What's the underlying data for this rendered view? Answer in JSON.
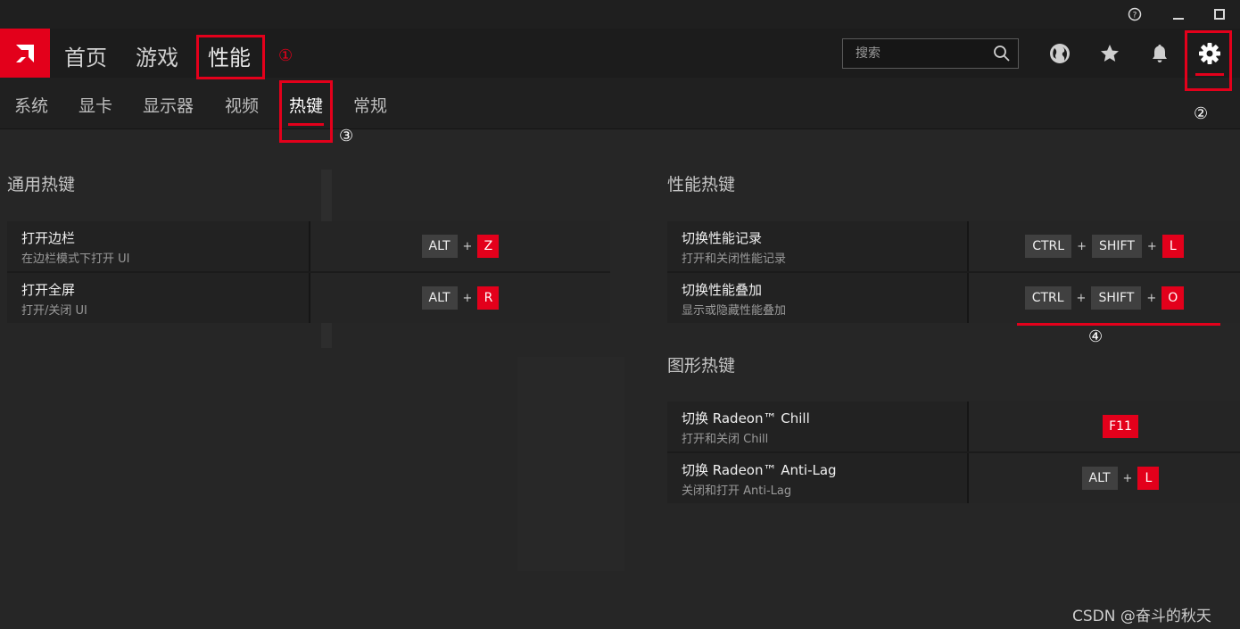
{
  "titlebar": {
    "help_icon": "question-circle-icon",
    "minimize_icon": "minimize-icon",
    "maximize_icon": "maximize-icon"
  },
  "topnav": {
    "items": [
      "首页",
      "游戏",
      "性能"
    ],
    "search_placeholder": "搜索",
    "icons": [
      "globe-icon",
      "star-icon",
      "bell-icon",
      "gear-icon"
    ]
  },
  "subnav": {
    "items": [
      "系统",
      "显卡",
      "显示器",
      "视频",
      "热键",
      "常规"
    ],
    "active": "热键"
  },
  "annotations": [
    "①",
    "②",
    "③",
    "④"
  ],
  "general_hotkeys": {
    "title": "通用热键",
    "rows": [
      {
        "name": "打开边栏",
        "desc": "在边栏模式下打开 UI",
        "keys": [
          "ALT",
          "Z"
        ]
      },
      {
        "name": "打开全屏",
        "desc": "打开/关闭 UI",
        "keys": [
          "ALT",
          "R"
        ]
      }
    ]
  },
  "perf_hotkeys": {
    "title": "性能热键",
    "rows": [
      {
        "name": "切换性能记录",
        "desc": "打开和关闭性能记录",
        "keys": [
          "CTRL",
          "SHIFT",
          "L"
        ]
      },
      {
        "name": "切换性能叠加",
        "desc": "显示或隐藏性能叠加",
        "keys": [
          "CTRL",
          "SHIFT",
          "O"
        ]
      }
    ]
  },
  "graphics_hotkeys": {
    "title": "图形热键",
    "rows": [
      {
        "name": "切换 Radeon™ Chill",
        "desc": "打开和关闭 Chill",
        "keys": [
          "F11"
        ]
      },
      {
        "name": "切换 Radeon™ Anti-Lag",
        "desc": "关闭和打开 Anti-Lag",
        "keys": [
          "ALT",
          "L"
        ]
      }
    ]
  },
  "plus_sign": "+",
  "watermark": "CSDN @奋斗的秋天",
  "colors": {
    "accent": "#e3001b",
    "background": "#262626",
    "key": "#404040"
  }
}
